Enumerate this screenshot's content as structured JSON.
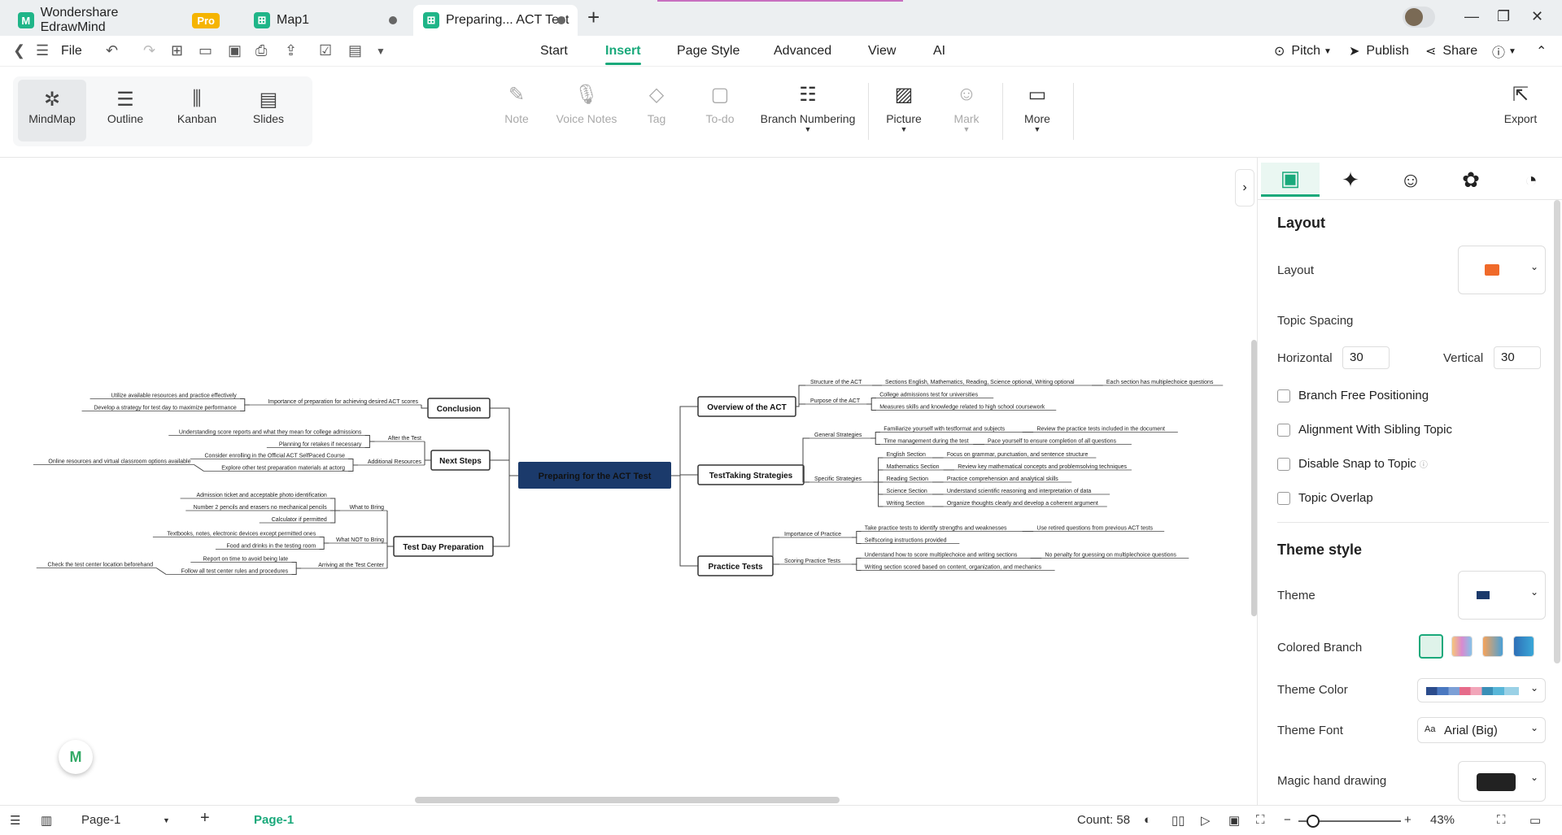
{
  "tabs": [
    {
      "label": "Wondershare EdrawMind",
      "badge": "Pro"
    },
    {
      "label": "Map1"
    },
    {
      "label": "Preparing... ACT Test"
    }
  ],
  "menu": {
    "file": "File",
    "items": [
      "Start",
      "Insert",
      "Page Style",
      "Advanced",
      "View",
      "AI"
    ],
    "selected": "Insert",
    "pitch": "Pitch",
    "publish": "Publish",
    "share": "Share"
  },
  "views": [
    "MindMap",
    "Outline",
    "Kanban",
    "Slides"
  ],
  "ribbon": {
    "note": "Note",
    "voice": "Voice Notes",
    "tag": "Tag",
    "todo": "To-do",
    "branch": "Branch Numbering",
    "picture": "Picture",
    "mark": "Mark",
    "more": "More",
    "export": "Export"
  },
  "mindmap": {
    "central": "Preparing for the ACT Test",
    "right": [
      {
        "title": "Overview of the ACT",
        "subs": [
          {
            "label": "Structure of the ACT",
            "items": [
              [
                "Sections English, Mathematics, Reading, Science optional, Writing optional",
                "Each section has multiplechoice questions"
              ]
            ]
          },
          {
            "label": "Purpose of the ACT",
            "items": [
              [
                "College admissions test for universities",
                ""
              ],
              [
                "Measures skills and knowledge related to high school coursework",
                ""
              ]
            ]
          }
        ]
      },
      {
        "title": "TestTaking Strategies",
        "subs": [
          {
            "label": "General Strategies",
            "items": [
              [
                "Familiarize yourself with testformat and subjects",
                "Review the practice tests included in the document"
              ],
              [
                "Time management during the test",
                "Pace yourself to ensure completion of all questions"
              ]
            ]
          },
          {
            "label": "Specific Strategies",
            "items": [
              [
                "English Section",
                "Focus on grammar, punctuation, and sentence structure"
              ],
              [
                "Mathematics Section",
                "Review key mathematical concepts and problemsolving techniques"
              ],
              [
                "Reading Section",
                "Practice comprehension and analytical skills"
              ],
              [
                "Science Section",
                "Understand scientific reasoning and interpretation of data"
              ],
              [
                "Writing Section",
                "Organize thoughts clearly and develop a coherent argument"
              ]
            ]
          }
        ]
      },
      {
        "title": "Practice Tests",
        "subs": [
          {
            "label": "Importance of Practice",
            "items": [
              [
                "Take practice tests to identify strengths and weaknesses",
                "Use retired questions from previous ACT tests"
              ],
              [
                "Selfscoring instructions provided",
                ""
              ]
            ]
          },
          {
            "label": "Scoring Practice Tests",
            "items": [
              [
                "Understand how to score multiplechoice and writing sections",
                "No penalty for guessing on multiplechoice questions"
              ],
              [
                "",
                "Writing section scored based on content, organization, and mechanics"
              ]
            ]
          }
        ]
      }
    ],
    "left": [
      {
        "title": "Conclusion",
        "subs": [
          {
            "label": "Importance of preparation for achieving desired ACT scores",
            "items": [
              "Utilize available resources and practice effectively",
              "Develop a strategy for test day to maximize performance"
            ]
          }
        ]
      },
      {
        "title": "Next Steps",
        "subs": [
          {
            "label": "After the Test",
            "items": [
              "Understanding score reports and what they mean for college admissions",
              "Planning for retakes if necessary"
            ]
          },
          {
            "label": "Additional Resources",
            "items": [
              "Consider enrolling in the Official ACT SelfPaced Course",
              "Explore other test preparation materials at actorg"
            ],
            "extra": "Online resources and virtual classroom options available"
          }
        ]
      },
      {
        "title": "Test Day Preparation",
        "subs": [
          {
            "label": "What to Bring",
            "items": [
              "Admission ticket and acceptable photo identification",
              "Number 2 pencils and erasers no mechanical pencils",
              "Calculator if permitted"
            ]
          },
          {
            "label": "What NOT to Bring",
            "items": [
              "Textbooks, notes, electronic devices except permitted ones",
              "Food and drinks in the testing room"
            ]
          },
          {
            "label": "Arriving at the Test Center",
            "items": [
              "Report on time to avoid being late",
              "Follow all test center rules and procedures"
            ],
            "extra": "Check the test center location beforehand"
          }
        ]
      }
    ]
  },
  "panel": {
    "layout_heading": "Layout",
    "layout_label": "Layout",
    "topic_spacing": "Topic Spacing",
    "horizontal": "Horizontal",
    "horizontal_val": "30",
    "vertical": "Vertical",
    "vertical_val": "30",
    "checks": [
      "Branch Free Positioning",
      "Alignment With Sibling Topic",
      "Disable Snap to Topic",
      "Topic Overlap"
    ],
    "theme_heading": "Theme style",
    "theme": "Theme",
    "colored_branch": "Colored Branch",
    "theme_color": "Theme Color",
    "theme_font": "Theme Font",
    "theme_font_val": "Arial (Big)",
    "magic": "Magic hand drawing"
  },
  "status": {
    "page_select": "Page-1",
    "page_tab": "Page-1",
    "count": "Count: 58",
    "zoom": "43%"
  },
  "colors": {
    "accent": "#1aa97b",
    "central": "#1b3a6b"
  }
}
